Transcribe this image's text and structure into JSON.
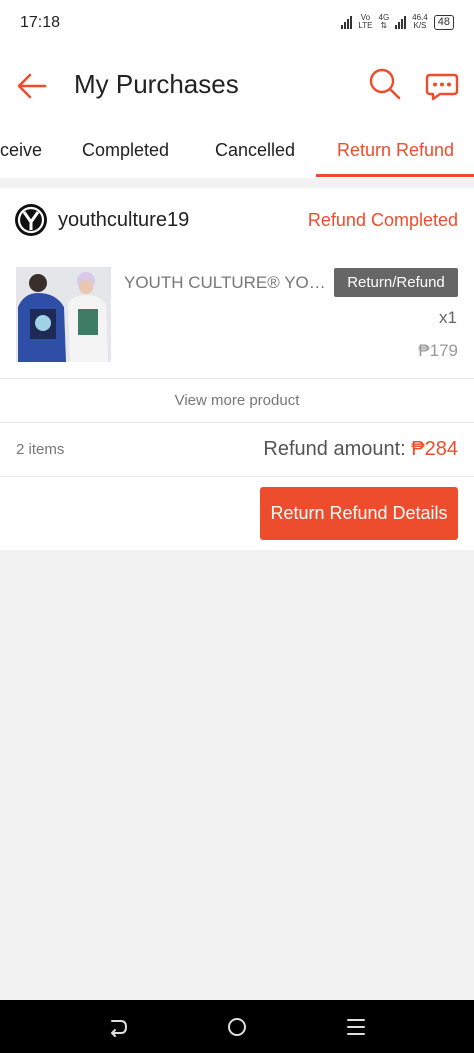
{
  "status_bar": {
    "time": "17:18",
    "network_top": "Vo",
    "network_bottom": "LTE",
    "gen": "4G",
    "speed_value": "46.4",
    "speed_unit": "K/S",
    "battery": "48"
  },
  "header": {
    "title": "My Purchases",
    "back_icon": "arrow-left-icon",
    "search_icon": "search-icon",
    "chat_icon": "chat-icon"
  },
  "tabs": {
    "items": [
      "ceive",
      "Completed",
      "Cancelled",
      "Return Refund"
    ],
    "active": "Return Refund"
  },
  "order": {
    "shop_name": "youthculture19",
    "status": "Refund Completed",
    "product": {
      "name": "YOUTH CULTURE® YOUTH CULTURE",
      "badge": "Return/Refund",
      "quantity": "x1",
      "price": "₱179"
    },
    "view_more": "View more product",
    "items_count": "2 items",
    "refund_label": "Refund amount: ",
    "refund_amount": "₱284",
    "details_button": "Return Refund Details"
  },
  "colors": {
    "accent": "#ee4d2d",
    "background": "#f2f2f2"
  }
}
